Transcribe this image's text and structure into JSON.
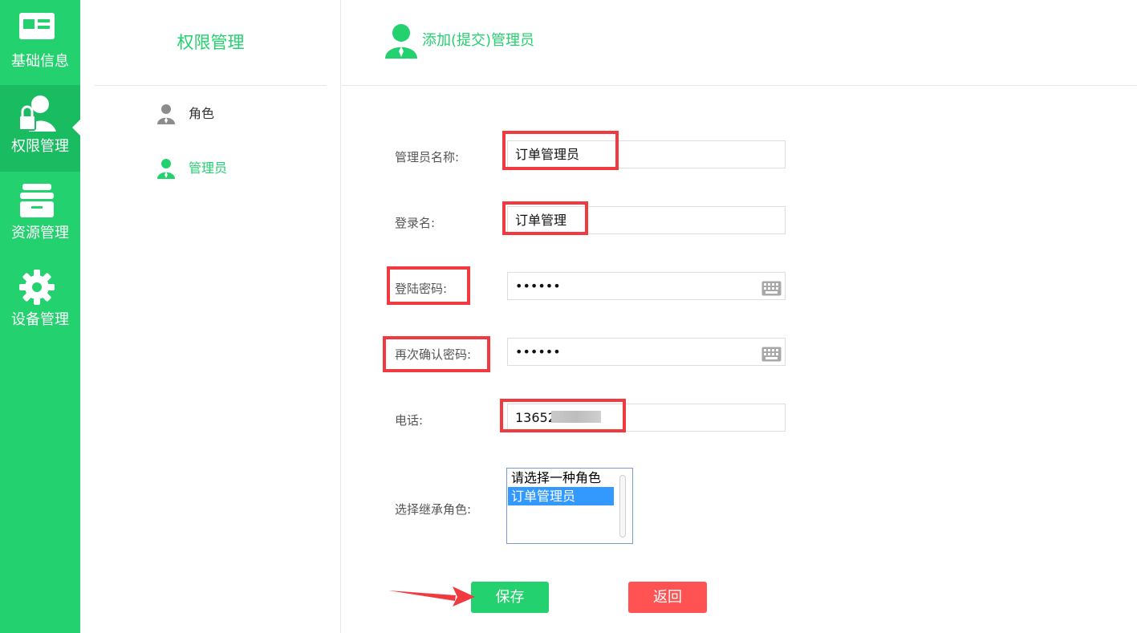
{
  "sidebar": {
    "items": [
      {
        "label": "基础信息",
        "icon": "id-card-icon"
      },
      {
        "label": "权限管理",
        "icon": "user-lock-icon",
        "active": true
      },
      {
        "label": "资源管理",
        "icon": "archive-box-icon"
      },
      {
        "label": "设备管理",
        "icon": "gear-icon"
      }
    ]
  },
  "subnav": {
    "title": "权限管理",
    "items": [
      {
        "label": "角色",
        "icon": "user-gray-icon"
      },
      {
        "label": "管理员",
        "icon": "user-green-icon",
        "active": true
      }
    ]
  },
  "header": {
    "title": "添加(提交)管理员",
    "icon": "admin-user-icon"
  },
  "form": {
    "admin_name": {
      "label": "管理员名称:",
      "value": "订单管理员"
    },
    "login_name": {
      "label": "登录名:",
      "value": "订单管理"
    },
    "password": {
      "label": "登陆密码:",
      "value": "••••••"
    },
    "confirm_password": {
      "label": "再次确认密码:",
      "value": "••••••"
    },
    "phone": {
      "label": "电话:",
      "value": "13652"
    },
    "role_select": {
      "label": "选择继承角色:",
      "options": [
        "请选择一种角色",
        "订单管理员"
      ],
      "selected": "订单管理员"
    }
  },
  "buttons": {
    "save_label": "保存",
    "back_label": "返回"
  },
  "colors": {
    "brand_green": "#23d16e",
    "active_green": "#19bc61",
    "danger_red": "#ff5252",
    "annotation_red": "#f03a3f",
    "select_blue": "#3399ff"
  }
}
